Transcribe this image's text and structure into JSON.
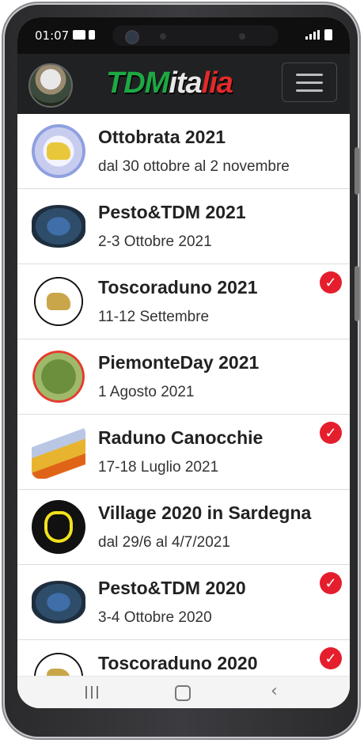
{
  "status_bar": {
    "time": "01:07"
  },
  "header": {
    "logo_part1": "TDM",
    "logo_part2": "ita",
    "logo_part3": "lia",
    "menu_icon": "hamburger-menu-icon",
    "brand_colors": {
      "green": "#1ea843",
      "white": "#e8e8e8",
      "red": "#e22a2a",
      "header_bg": "#202123"
    }
  },
  "events": [
    {
      "title": "Ottobrata 2021",
      "dates": "dal 30 ottobre al 2 novembre",
      "completed": false
    },
    {
      "title": "Pesto&TDM 2021",
      "dates": "2-3 Ottobre 2021",
      "completed": false
    },
    {
      "title": "Toscoraduno 2021",
      "dates": "11-12 Settembre",
      "completed": true
    },
    {
      "title": "PiemonteDay 2021",
      "dates": "1 Agosto 2021",
      "completed": false
    },
    {
      "title": "Raduno Canocchie",
      "dates": "17-18 Luglio 2021",
      "completed": true
    },
    {
      "title": "Village 2020 in Sardegna",
      "dates": "dal 29/6 al 4/7/2021",
      "completed": false
    },
    {
      "title": "Pesto&TDM 2020",
      "dates": "3-4 Ottobre 2020",
      "completed": true
    },
    {
      "title": "Toscoraduno 2020",
      "dates": "",
      "completed": true
    }
  ],
  "check_color": "#e41e2c",
  "nav_bar": {
    "recent_icon": "recent-apps-icon",
    "home_icon": "home-icon",
    "back_icon": "back-icon"
  }
}
